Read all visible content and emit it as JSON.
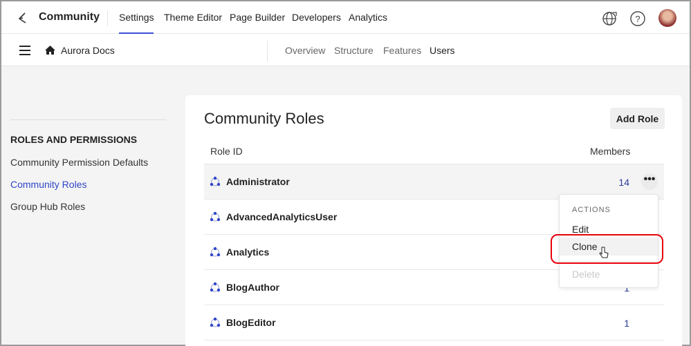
{
  "topnav": {
    "brand": "Community",
    "items": [
      "Settings",
      "Theme Editor",
      "Page Builder",
      "Developers",
      "Analytics"
    ],
    "active": "Settings"
  },
  "subbar": {
    "site": "Aurora Docs",
    "tabs": [
      "Overview",
      "Structure",
      "Features",
      "Users"
    ],
    "active": "Users"
  },
  "sidebar": {
    "heading": "ROLES AND PERMISSIONS",
    "items": [
      "Community Permission Defaults",
      "Community Roles",
      "Group Hub Roles"
    ],
    "active": "Community Roles"
  },
  "main": {
    "title": "Community Roles",
    "add_button": "Add Role",
    "columns": [
      "Role ID",
      "Members"
    ],
    "rows": [
      {
        "name": "Administrator",
        "members": "14"
      },
      {
        "name": "AdvancedAnalyticsUser",
        "members": ""
      },
      {
        "name": "Analytics",
        "members": ""
      },
      {
        "name": "BlogAuthor",
        "members": "1"
      },
      {
        "name": "BlogEditor",
        "members": "1"
      }
    ]
  },
  "menu": {
    "heading": "ACTIONS",
    "items": [
      "Edit",
      "Clone",
      "Delete"
    ],
    "highlighted": "Clone",
    "disabled": "Delete"
  },
  "colors": {
    "accent": "#3b4fd8",
    "highlight": "#e8000b",
    "link": "#2b3a9a"
  }
}
